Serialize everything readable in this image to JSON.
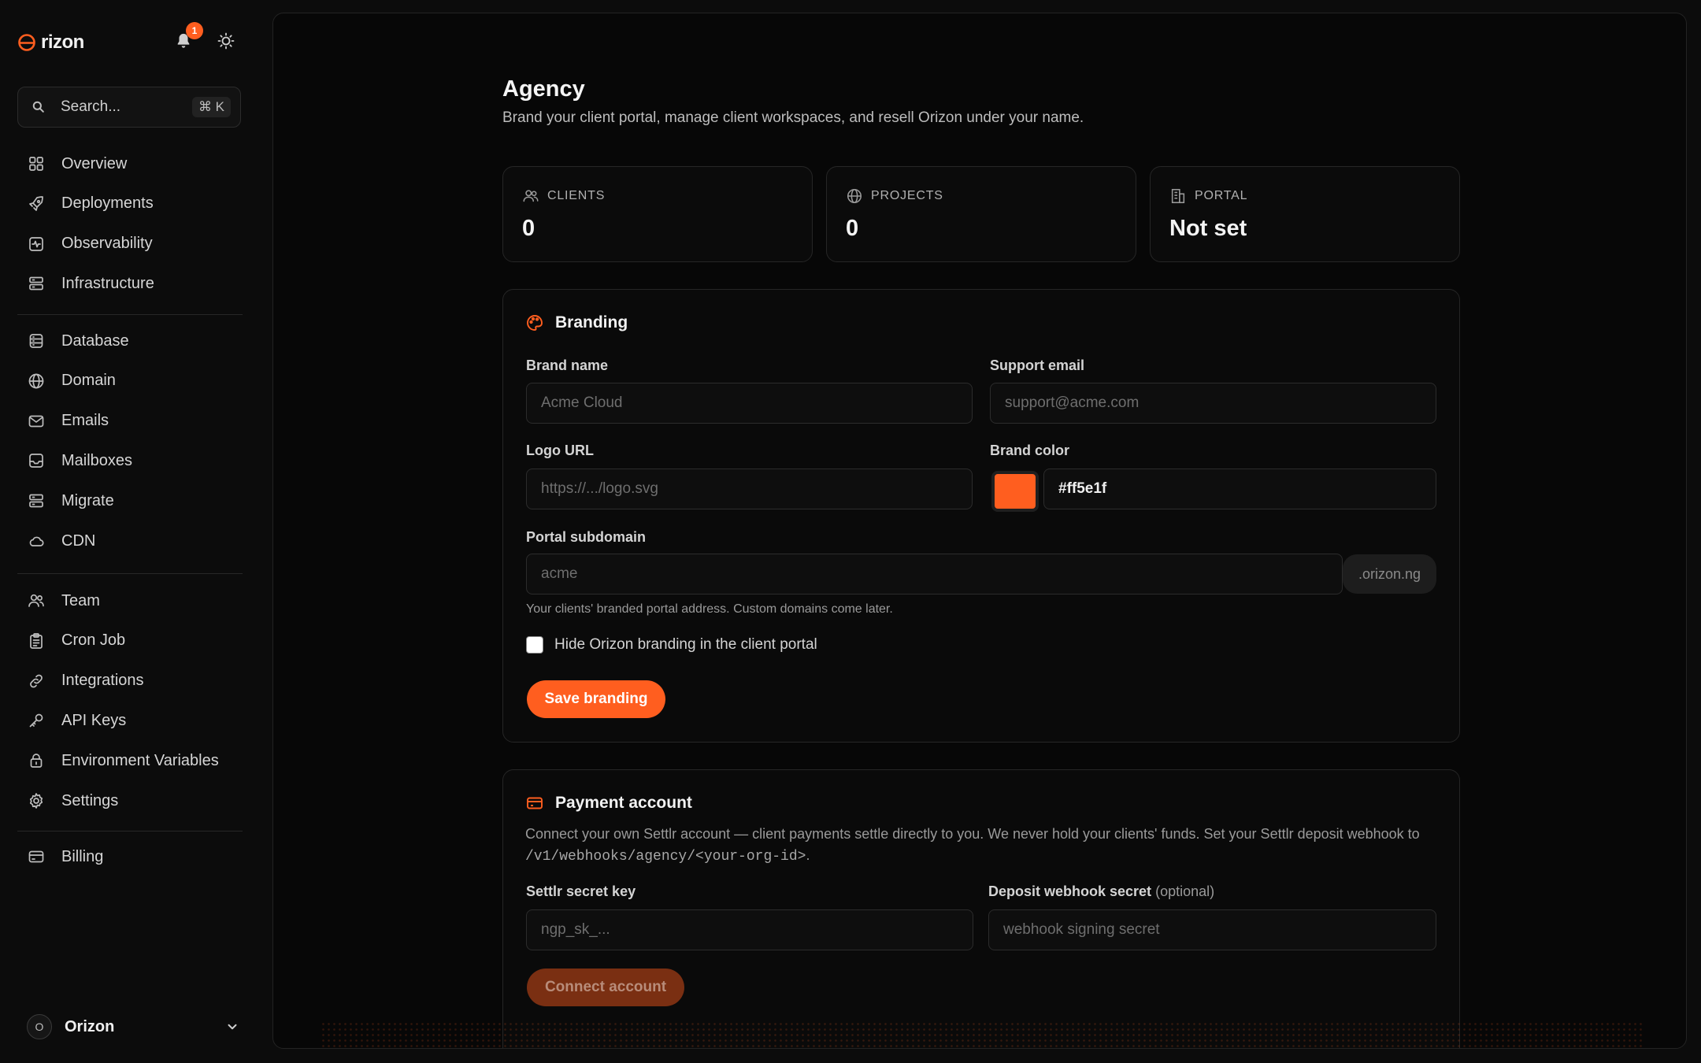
{
  "app": {
    "name": "rizon",
    "notification_count": "1"
  },
  "search": {
    "placeholder": "Search...",
    "shortcut": "⌘ K"
  },
  "sidebar": {
    "groups": [
      [
        {
          "label": "Overview",
          "icon": "grid-icon"
        },
        {
          "label": "Deployments",
          "icon": "rocket-icon"
        },
        {
          "label": "Observability",
          "icon": "activity-icon"
        },
        {
          "label": "Infrastructure",
          "icon": "server-icon"
        }
      ],
      [
        {
          "label": "Database",
          "icon": "database-icon"
        },
        {
          "label": "Domain",
          "icon": "globe-icon"
        },
        {
          "label": "Emails",
          "icon": "mail-icon"
        },
        {
          "label": "Mailboxes",
          "icon": "inbox-icon"
        },
        {
          "label": "Migrate",
          "icon": "server-icon"
        },
        {
          "label": "CDN",
          "icon": "cloud-icon"
        }
      ],
      [
        {
          "label": "Team",
          "icon": "users-icon"
        },
        {
          "label": "Cron Job",
          "icon": "clipboard-icon"
        },
        {
          "label": "Integrations",
          "icon": "link-icon"
        },
        {
          "label": "API Keys",
          "icon": "key-icon"
        },
        {
          "label": "Environment Variables",
          "icon": "lock-icon"
        },
        {
          "label": "Settings",
          "icon": "gear-icon"
        }
      ],
      [
        {
          "label": "Billing",
          "icon": "credit-card-icon"
        }
      ]
    ]
  },
  "org": {
    "initial": "O",
    "name": "Orizon"
  },
  "page": {
    "title": "Agency",
    "subtitle": "Brand your client portal, manage client workspaces, and resell Orizon under your name."
  },
  "stats": [
    {
      "label": "CLIENTS",
      "value": "0",
      "icon": "users-icon"
    },
    {
      "label": "PROJECTS",
      "value": "0",
      "icon": "globe-icon"
    },
    {
      "label": "PORTAL",
      "value": "Not set",
      "icon": "building-icon"
    }
  ],
  "branding": {
    "title": "Branding",
    "brand_name_label": "Brand name",
    "brand_name_placeholder": "Acme Cloud",
    "support_email_label": "Support email",
    "support_email_placeholder": "support@acme.com",
    "logo_url_label": "Logo URL",
    "logo_url_placeholder": "https://.../logo.svg",
    "brand_color_label": "Brand color",
    "brand_color_value": "#ff5e1f",
    "subdomain_label": "Portal subdomain",
    "subdomain_placeholder": "acme",
    "subdomain_suffix": ".orizon.ng",
    "subdomain_help": "Your clients' branded portal address. Custom domains come later.",
    "hide_branding_label": "Hide Orizon branding in the client portal",
    "save_label": "Save branding"
  },
  "payment": {
    "title": "Payment account",
    "desc_part1": "Connect your own Settlr account — client payments settle directly to you. We never hold your clients' funds. Set your Settlr deposit webhook to ",
    "desc_code": "/v1/webhooks/agency/<your-org-id>",
    "desc_part2": ".",
    "secret_key_label": "Settlr secret key",
    "secret_key_placeholder": "ngp_sk_...",
    "webhook_label": "Deposit webhook secret",
    "webhook_optional": "(optional)",
    "webhook_placeholder": "webhook signing secret",
    "connect_label": "Connect account"
  },
  "colors": {
    "accent": "#ff5e1f",
    "background": "#0c0c0c",
    "panel": "#070707"
  }
}
